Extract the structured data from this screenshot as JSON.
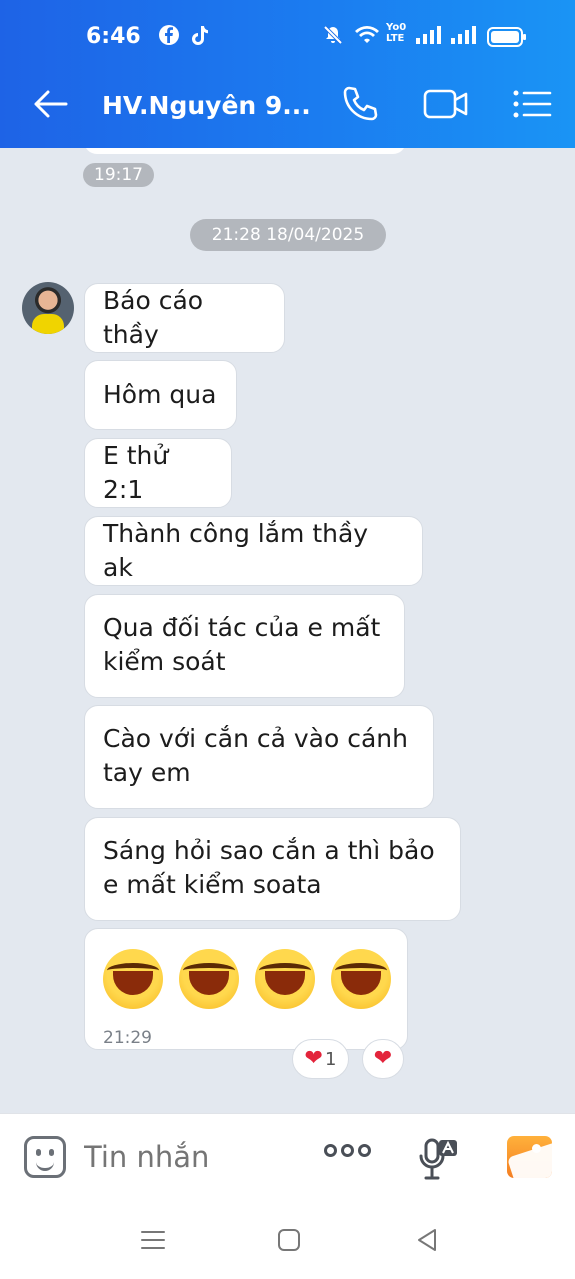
{
  "status_bar": {
    "time": "6:46",
    "icons": [
      "facebook-icon",
      "tiktok-icon",
      "mute-icon",
      "wifi-icon",
      "volte-icon",
      "signal-icon",
      "signal-icon",
      "battery-icon"
    ],
    "network_label_top": "Yo0",
    "network_label_bottom": "LTE"
  },
  "header": {
    "back_icon": "arrow-left-icon",
    "title": "HV.Nguyên 9...",
    "call_icon": "phone-icon",
    "video_icon": "video-camera-icon",
    "menu_icon": "list-menu-icon"
  },
  "chat": {
    "prev_time": "19:17",
    "date_divider": "21:28 18/04/2025",
    "messages": [
      {
        "text": "Báo cáo thầy"
      },
      {
        "text": "Hôm qua"
      },
      {
        "text": "E thử 2:1"
      },
      {
        "text": "Thành công lắm thầy ak"
      },
      {
        "line1": "Qua đối tác của e mất",
        "line2": "kiểm soát"
      },
      {
        "line1": "Cào với cắn cả vào cánh",
        "line2": "tay em"
      },
      {
        "line1": "Sáng hỏi sao cắn a thì bảo",
        "line2": "e mất kiểm soata"
      }
    ],
    "emoji_message": {
      "emojis": [
        "face-with-tears-of-joy",
        "face-with-tears-of-joy",
        "face-with-tears-of-joy",
        "face-with-tears-of-joy"
      ],
      "time": "21:29"
    },
    "reactions": [
      {
        "icon": "heart-icon",
        "count": "1"
      },
      {
        "icon": "heart-icon"
      }
    ],
    "colors": {
      "heart": "#e3243b",
      "header_start": "#1e63e6",
      "header_end": "#1a94f5",
      "background": "#e3e8ef"
    }
  },
  "composer": {
    "sticker_icon": "sticker-smile-icon",
    "placeholder": "Tin nhắn",
    "more_icon": "more-dots-icon",
    "voice_icon": "voice-to-text-icon",
    "gallery_icon": "gallery-icon"
  },
  "nav": {
    "icons": [
      "recent-apps-icon",
      "home-icon",
      "back-icon"
    ]
  }
}
